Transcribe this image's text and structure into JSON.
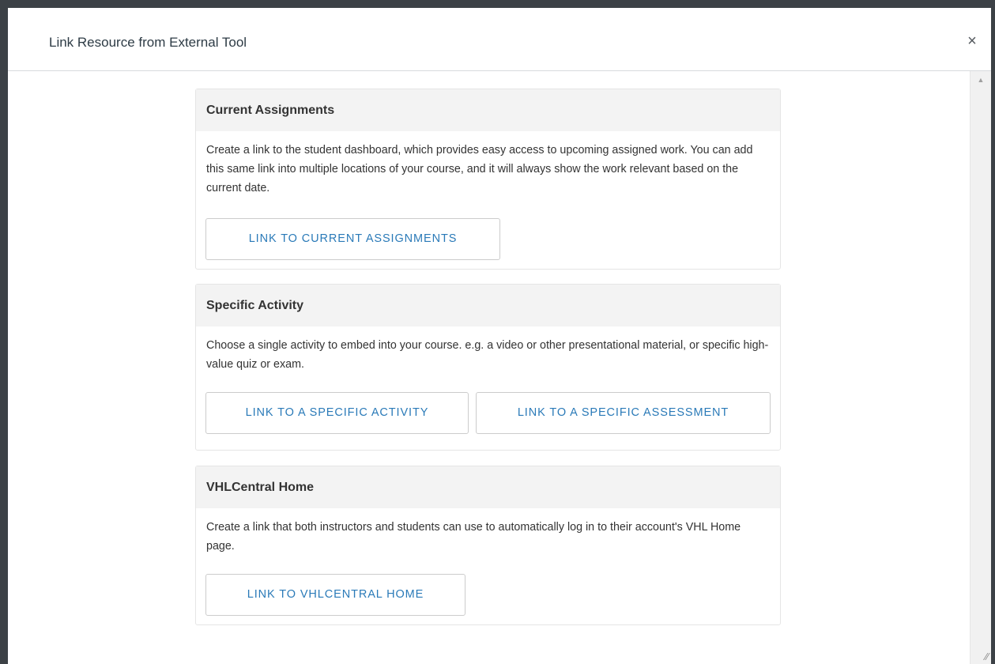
{
  "dialog": {
    "title": "Link Resource from External Tool",
    "close_glyph": "×"
  },
  "panels": [
    {
      "heading": "Current Assignments",
      "description": "Create a link to the student dashboard, which provides easy access to upcoming assigned work. You can add this same link into multiple locations of your course, and it will always show the work relevant based on the current date.",
      "buttons": [
        "LINK TO CURRENT ASSIGNMENTS"
      ]
    },
    {
      "heading": "Specific Activity",
      "description": "Choose a single activity to embed into your course. e.g. a video or other presentational material, or specific high-value quiz or exam.",
      "buttons": [
        "LINK TO A SPECIFIC ACTIVITY",
        "LINK TO A SPECIFIC ASSESSMENT"
      ]
    },
    {
      "heading": "VHLCentral Home",
      "description": "Create a link that both instructors and students can use to automatically log in to their account's VHL Home page.",
      "buttons": [
        "LINK TO VHLCENTRAL HOME"
      ]
    }
  ],
  "scrollbar": {
    "up_arrow_glyph": "▲",
    "resize_grip_glyph": "⁄⁄"
  },
  "colors": {
    "backdrop": "#3c4146",
    "button_text": "#2a7ab8",
    "panel_header_bg": "#f3f3f3"
  }
}
